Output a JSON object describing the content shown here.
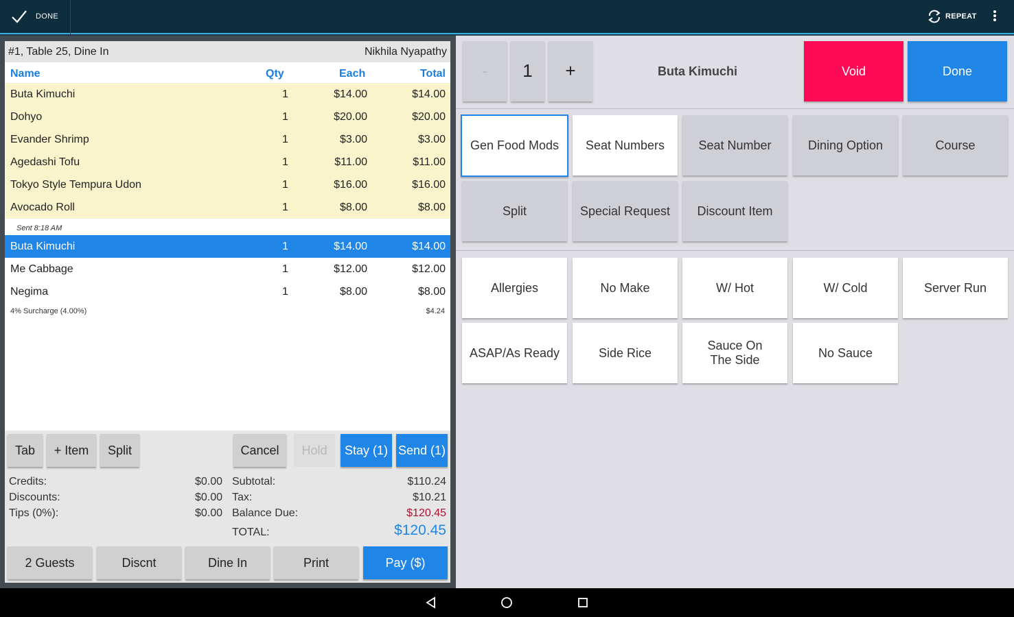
{
  "topbar": {
    "done_label": "DONE",
    "repeat_label": "REPEAT"
  },
  "order": {
    "header_left": "#1, Table 25, Dine In",
    "server": "Nikhila Nyapathy",
    "columns": {
      "name": "Name",
      "qty": "Qty",
      "each": "Each",
      "total": "Total"
    },
    "sent_items": [
      {
        "name": "Buta Kimuchi",
        "qty": "1",
        "each": "$14.00",
        "total": "$14.00"
      },
      {
        "name": "Dohyo",
        "qty": "1",
        "each": "$20.00",
        "total": "$20.00"
      },
      {
        "name": "Evander Shrimp",
        "qty": "1",
        "each": "$3.00",
        "total": "$3.00"
      },
      {
        "name": "Agedashi Tofu",
        "qty": "1",
        "each": "$11.00",
        "total": "$11.00"
      },
      {
        "name": "Tokyo Style Tempura Udon",
        "qty": "1",
        "each": "$16.00",
        "total": "$16.00"
      },
      {
        "name": "Avocado Roll",
        "qty": "1",
        "each": "$8.00",
        "total": "$8.00"
      }
    ],
    "sent_label": "Sent 8:18 AM",
    "new_items": [
      {
        "name": "Buta Kimuchi",
        "qty": "1",
        "each": "$14.00",
        "total": "$14.00"
      },
      {
        "name": "Me Cabbage",
        "qty": "1",
        "each": "$12.00",
        "total": "$12.00"
      },
      {
        "name": "Negima",
        "qty": "1",
        "each": "$8.00",
        "total": "$8.00"
      }
    ],
    "surcharge": {
      "label": "4% Surcharge (4.00%)",
      "value": "$4.24"
    }
  },
  "actions": {
    "tab": "Tab",
    "add_item": "+ Item",
    "split": "Split",
    "cancel": "Cancel",
    "hold": "Hold",
    "stay": "Stay (1)",
    "send": "Send (1)",
    "guests": "2 Guests",
    "discount": "Discnt",
    "dine_in": "Dine In",
    "print": "Print",
    "pay": "Pay ($)"
  },
  "totals": {
    "credits_label": "Credits:",
    "credits": "$0.00",
    "discounts_label": "Discounts:",
    "discounts": "$0.00",
    "tips_label": "Tips (0%):",
    "tips": "$0.00",
    "subtotal_label": "Subtotal:",
    "subtotal": "$110.24",
    "tax_label": "Tax:",
    "tax": "$10.21",
    "balance_label": "Balance Due:",
    "balance": "$120.45",
    "total_label": "TOTAL:",
    "total": "$120.45"
  },
  "item_editor": {
    "minus": "-",
    "quantity": "1",
    "plus": "+",
    "item_name": "Buta Kimuchi",
    "void": "Void",
    "done": "Done",
    "mod_groups": [
      "Gen Food Mods",
      "Seat Numbers",
      "Seat Number",
      "Dining Option",
      "Course",
      "Split",
      "Special Request",
      "Discount Item"
    ],
    "modifiers": [
      "Allergies",
      "No Make",
      "W/ Hot",
      "W/ Cold",
      "Server Run",
      "ASAP/As Ready",
      "Side Rice",
      "Sauce On The Side",
      "No Sauce"
    ]
  },
  "colors": {
    "accent_blue": "#1f86e8",
    "void_red": "#ff0a57",
    "sent_row": "#faf4cc",
    "balance_red": "#b01030"
  }
}
